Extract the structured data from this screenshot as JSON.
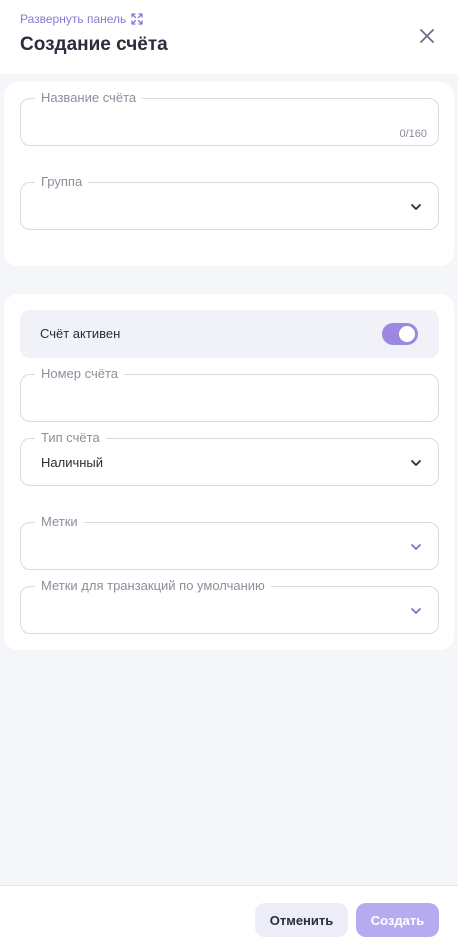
{
  "header": {
    "expand_label": "Развернуть панель",
    "title": "Создание счёта"
  },
  "form": {
    "name": {
      "label": "Название счёта",
      "value": "",
      "counter": "0/160"
    },
    "group": {
      "label": "Группа",
      "value": ""
    },
    "active": {
      "label": "Счёт активен",
      "enabled": true
    },
    "number": {
      "label": "Номер счёта",
      "value": ""
    },
    "type": {
      "label": "Тип счёта",
      "value": "Наличный"
    },
    "tags": {
      "label": "Метки",
      "value": ""
    },
    "default_tags": {
      "label": "Метки для транзакций по умолчанию",
      "value": ""
    }
  },
  "footer": {
    "cancel_label": "Отменить",
    "create_label": "Создать"
  },
  "colors": {
    "accent": "#9a89df",
    "accent_disabled": "#b8aaf0",
    "link": "#8d77d8"
  },
  "icons": [
    "expand-icon",
    "close-icon",
    "chevron-down-icon"
  ]
}
